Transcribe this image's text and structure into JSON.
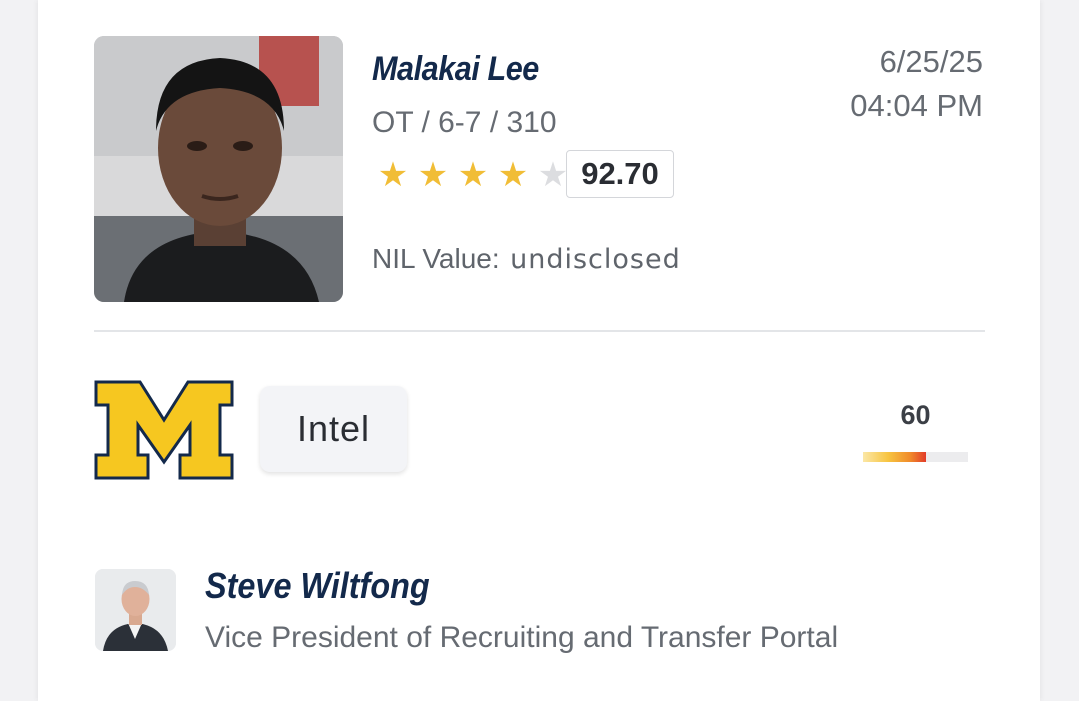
{
  "player": {
    "name": "Malakai Lee",
    "details": "OT / 6-7 / 310",
    "stars": 4,
    "max_stars": 5,
    "rating": "92.70",
    "nil_label": "NIL Value:",
    "nil_value": "undisclosed"
  },
  "timestamp": {
    "date": "6/25/25",
    "time": "04:04 PM"
  },
  "prediction": {
    "team_logo": "michigan-block-m-logo",
    "label": "Intel",
    "confidence": "60",
    "confidence_fraction": 0.6
  },
  "author": {
    "name": "Steve Wiltfong",
    "title": "Vice President of Recruiting and Transfer Portal"
  },
  "colors": {
    "navy": "#13294b",
    "maize": "#f6c720",
    "star": "#f1bd36"
  }
}
